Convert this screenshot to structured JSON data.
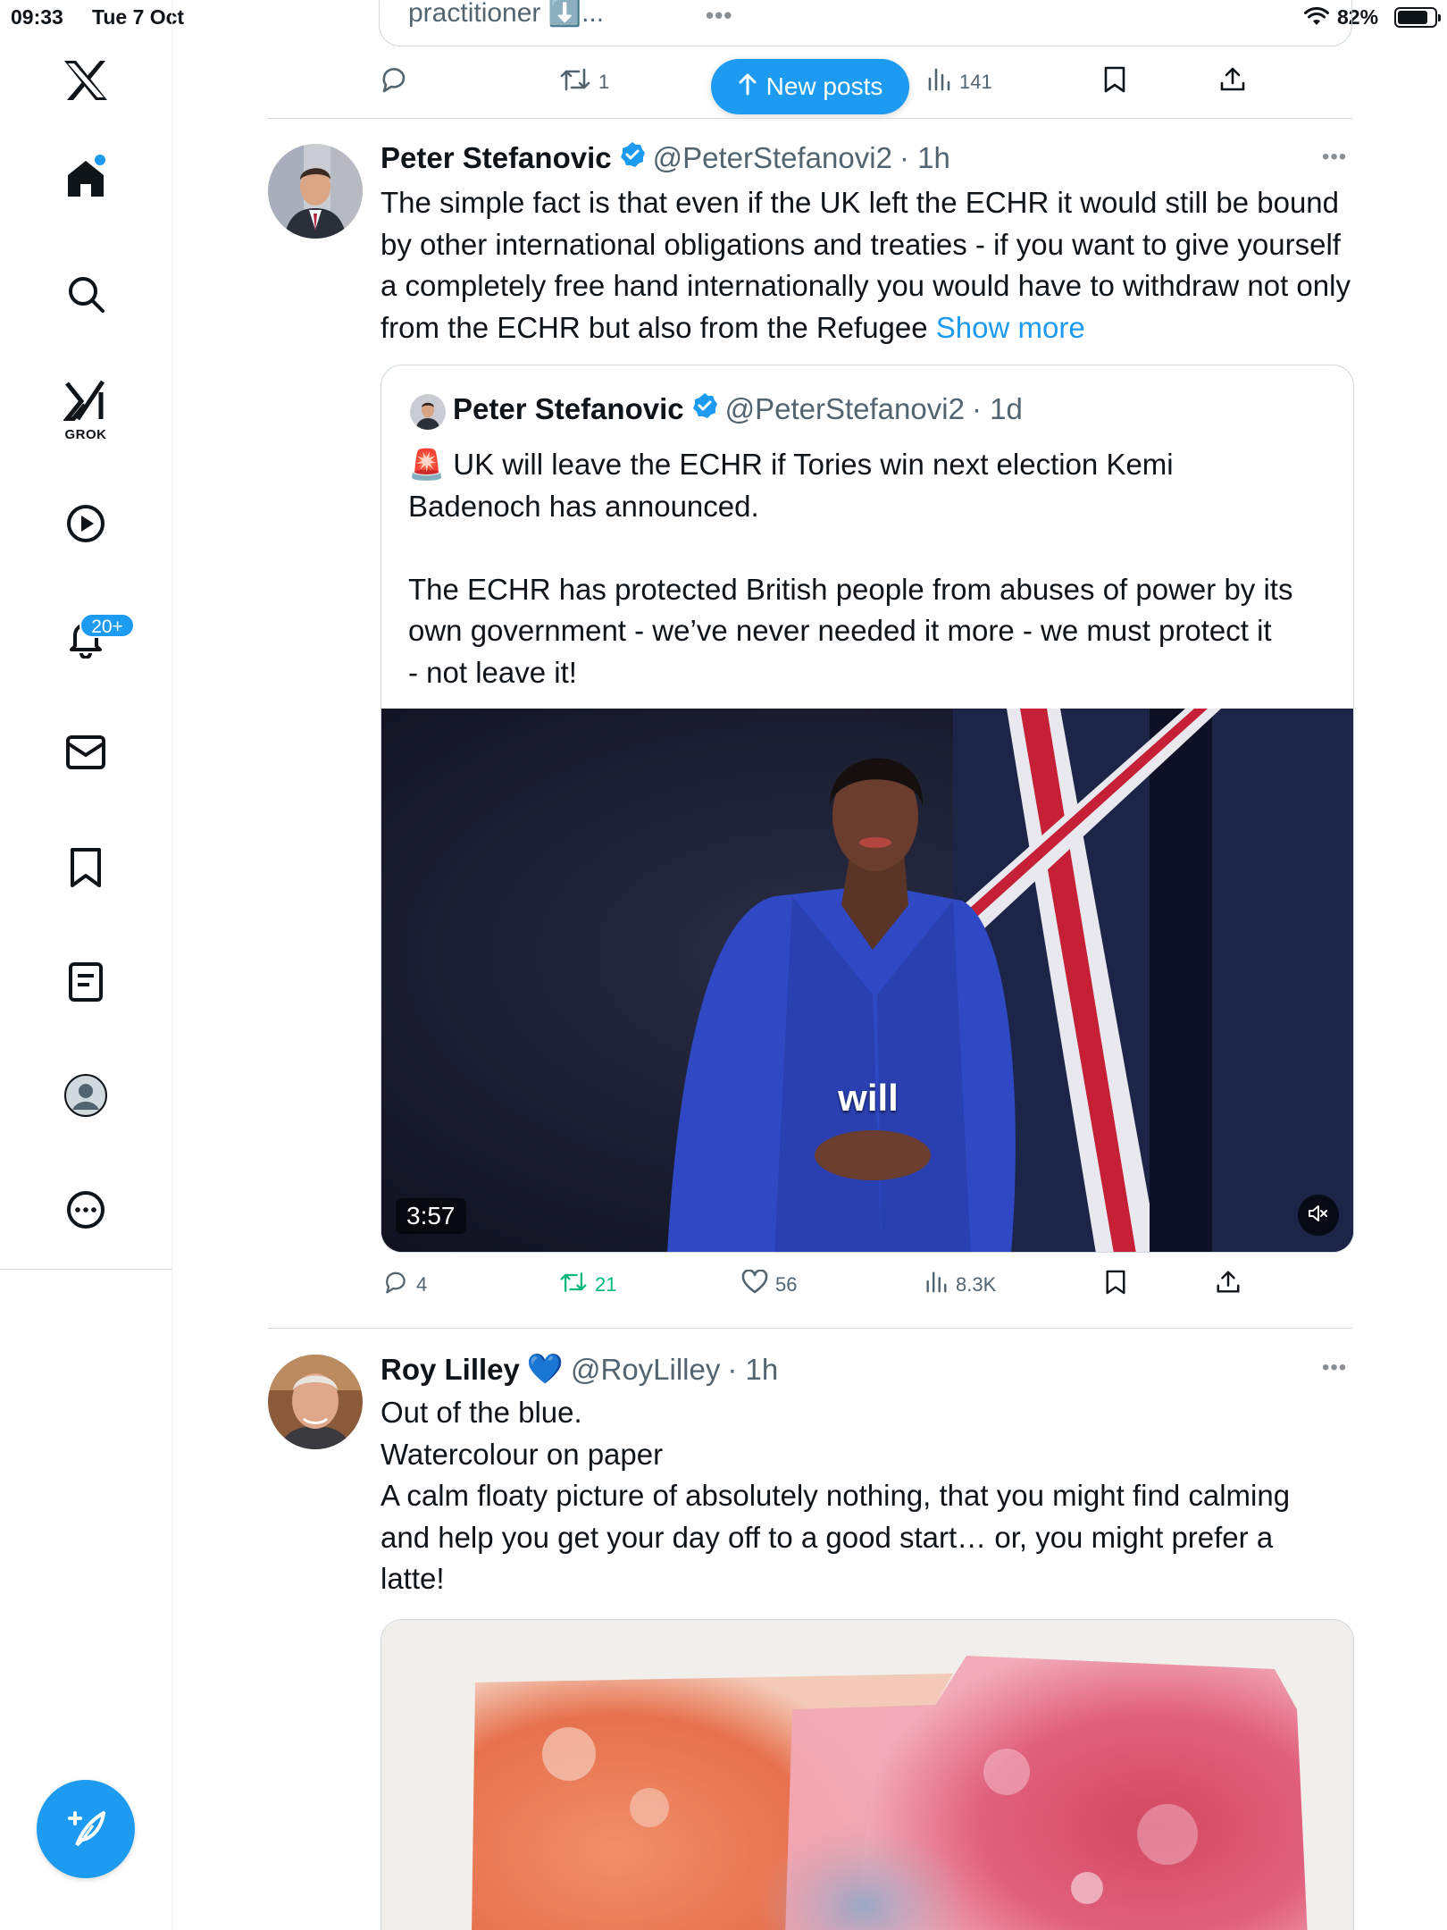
{
  "status_bar": {
    "time": "09:33",
    "date": "Tue 7 Oct",
    "battery": "82%",
    "battery_level": 0.82
  },
  "sidebar": {
    "items": [
      {
        "name": "home",
        "icon": "home-icon",
        "active": true
      },
      {
        "name": "explore",
        "icon": "search-icon"
      },
      {
        "name": "grok",
        "icon": "grok-icon",
        "label": "GROK"
      },
      {
        "name": "video",
        "icon": "play-icon"
      },
      {
        "name": "notifications",
        "icon": "bell-icon",
        "badge": "20+"
      },
      {
        "name": "messages",
        "icon": "mail-icon"
      },
      {
        "name": "bookmarks",
        "icon": "bookmark-icon"
      },
      {
        "name": "lists",
        "icon": "list-icon"
      },
      {
        "name": "profile",
        "icon": "profile-icon"
      },
      {
        "name": "more",
        "icon": "more-icon"
      }
    ],
    "compose_icon": "compose-icon"
  },
  "prev_tweet": {
    "snippet": "practitioner ⬇️...",
    "retweets": "1",
    "views": "141"
  },
  "new_posts_label": "New posts",
  "tweets": [
    {
      "name": "Peter Stefanovic",
      "handle": "@PeterStefanovi2",
      "time": "· 1h",
      "text": "The simple fact is that even if the UK left the ECHR it would still be bound by other international obligations and treaties - if you want to give yourself a completely free hand internationally you would have to withdraw not only from the ECHR but also from the Refugee ",
      "show_more": "Show more",
      "quote": {
        "name": "Peter Stefanovic",
        "handle": "@PeterStefanovi2",
        "time": "· 1d",
        "lines": [
          "🚨 UK will leave the ECHR if Tories win next election Kemi",
          "Badenoch has announced.",
          "",
          "The ECHR has protected British people from abuses of power by its",
          "own government - we’ve never needed it more - we must protect it",
          "- not leave it!"
        ],
        "video_duration": "3:57",
        "video_caption": "will"
      },
      "replies": "4",
      "retweets": "21",
      "likes": "56",
      "views": "8.3K"
    },
    {
      "name": "Roy Lilley",
      "name_emoji": "💙",
      "handle": "@RoyLilley",
      "time": "· 1h",
      "lines": [
        "Out of the blue.",
        "Watercolour on paper",
        "A calm floaty picture of absolutely nothing, that you might find calming",
        "and help you get your day off to a good start… or, you might prefer a",
        "latte!"
      ]
    }
  ],
  "colors": {
    "accent": "#1d9bf0",
    "retweet_green": "#00ba7c",
    "muted": "#536471",
    "text": "#0f1419"
  }
}
